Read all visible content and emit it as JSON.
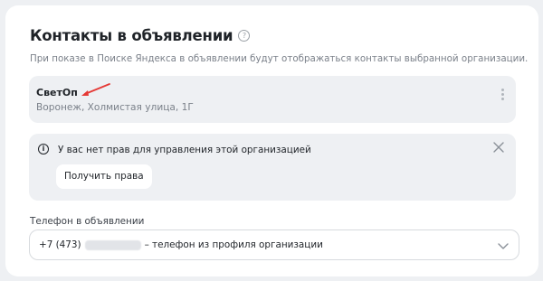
{
  "section": {
    "title": "Контакты в объявлении",
    "help_icon": "?",
    "subtitle": "При показе в Поиске Яндекса в объявлении будут отображаться контакты выбранной организации."
  },
  "organization": {
    "name": "СветОп",
    "address": "Воронеж, Холмистая улица, 1Г"
  },
  "alert": {
    "info_icon": "i",
    "text": "У вас нет прав для управления этой организацией",
    "button_label": "Получить права"
  },
  "phone": {
    "label": "Телефон в объявлении",
    "prefix": "+7 (473)",
    "suffix": "– телефон из профиля организации"
  },
  "colors": {
    "accent_arrow": "#e53935",
    "panel_bg": "#eef0f3"
  }
}
